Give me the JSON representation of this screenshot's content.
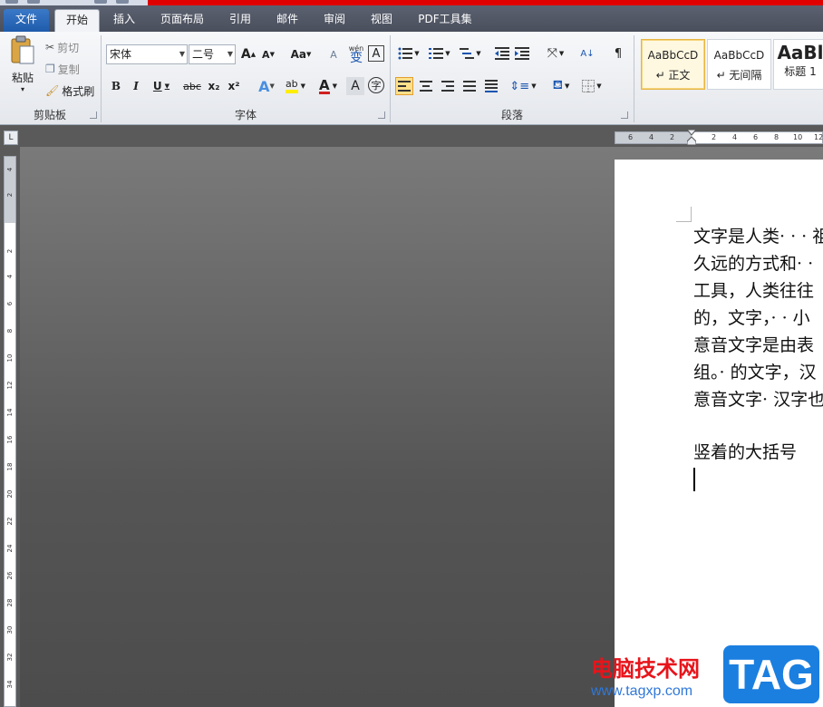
{
  "tabs": [
    {
      "label": "文件"
    },
    {
      "label": "开始"
    },
    {
      "label": "插入"
    },
    {
      "label": "页面布局"
    },
    {
      "label": "引用"
    },
    {
      "label": "邮件"
    },
    {
      "label": "审阅"
    },
    {
      "label": "视图"
    },
    {
      "label": "PDF工具集"
    }
  ],
  "clipboard": {
    "paste": "粘贴",
    "cut": "剪切",
    "copy": "复制",
    "format_painter": "格式刷",
    "label": "剪贴板"
  },
  "font": {
    "font_name": "宋体",
    "font_size": "二号",
    "grow": "A",
    "shrink": "A",
    "change_case": "Aa",
    "clear": "A",
    "pinyin": "wén",
    "pinyin_char": "变",
    "border_char": "A",
    "bold": "B",
    "italic": "I",
    "underline": "U",
    "strike": "abc",
    "subscript": "x₂",
    "superscript": "x²",
    "effects": "A",
    "highlight": "ab",
    "color": "A",
    "shading": "A",
    "enclose": "字",
    "label": "字体"
  },
  "paragraph": {
    "label": "段落",
    "sort": "A↓"
  },
  "styles": [
    {
      "preview": "AaBbCcD",
      "name": "↵ 正文"
    },
    {
      "preview": "AaBbCcD",
      "name": "↵ 无间隔"
    },
    {
      "preview": "AaBl",
      "name": "标题 1"
    }
  ],
  "ruler": {
    "corner": "L",
    "h_numbers": [
      "6",
      "4",
      "2",
      "2",
      "4",
      "6",
      "8",
      "10",
      "12"
    ],
    "v_numbers": [
      "4",
      "2",
      "2",
      "4",
      "6",
      "8",
      "10",
      "12",
      "14",
      "16",
      "18",
      "20",
      "22",
      "24",
      "26",
      "28",
      "30",
      "32",
      "34"
    ]
  },
  "document": {
    "lines": [
      "文字是人类· · · 祖",
      "久远的方式和· ·",
      "工具，人类往往",
      "的，文字，· · 小",
      "意音文字是由表",
      "组。· 的文字，汉",
      "意音文字· 汉字也"
    ],
    "heading": "竖着的大括号"
  },
  "watermark": {
    "title": "电脑技术网",
    "url": "www.tagxp.com",
    "tag": "TAG"
  }
}
